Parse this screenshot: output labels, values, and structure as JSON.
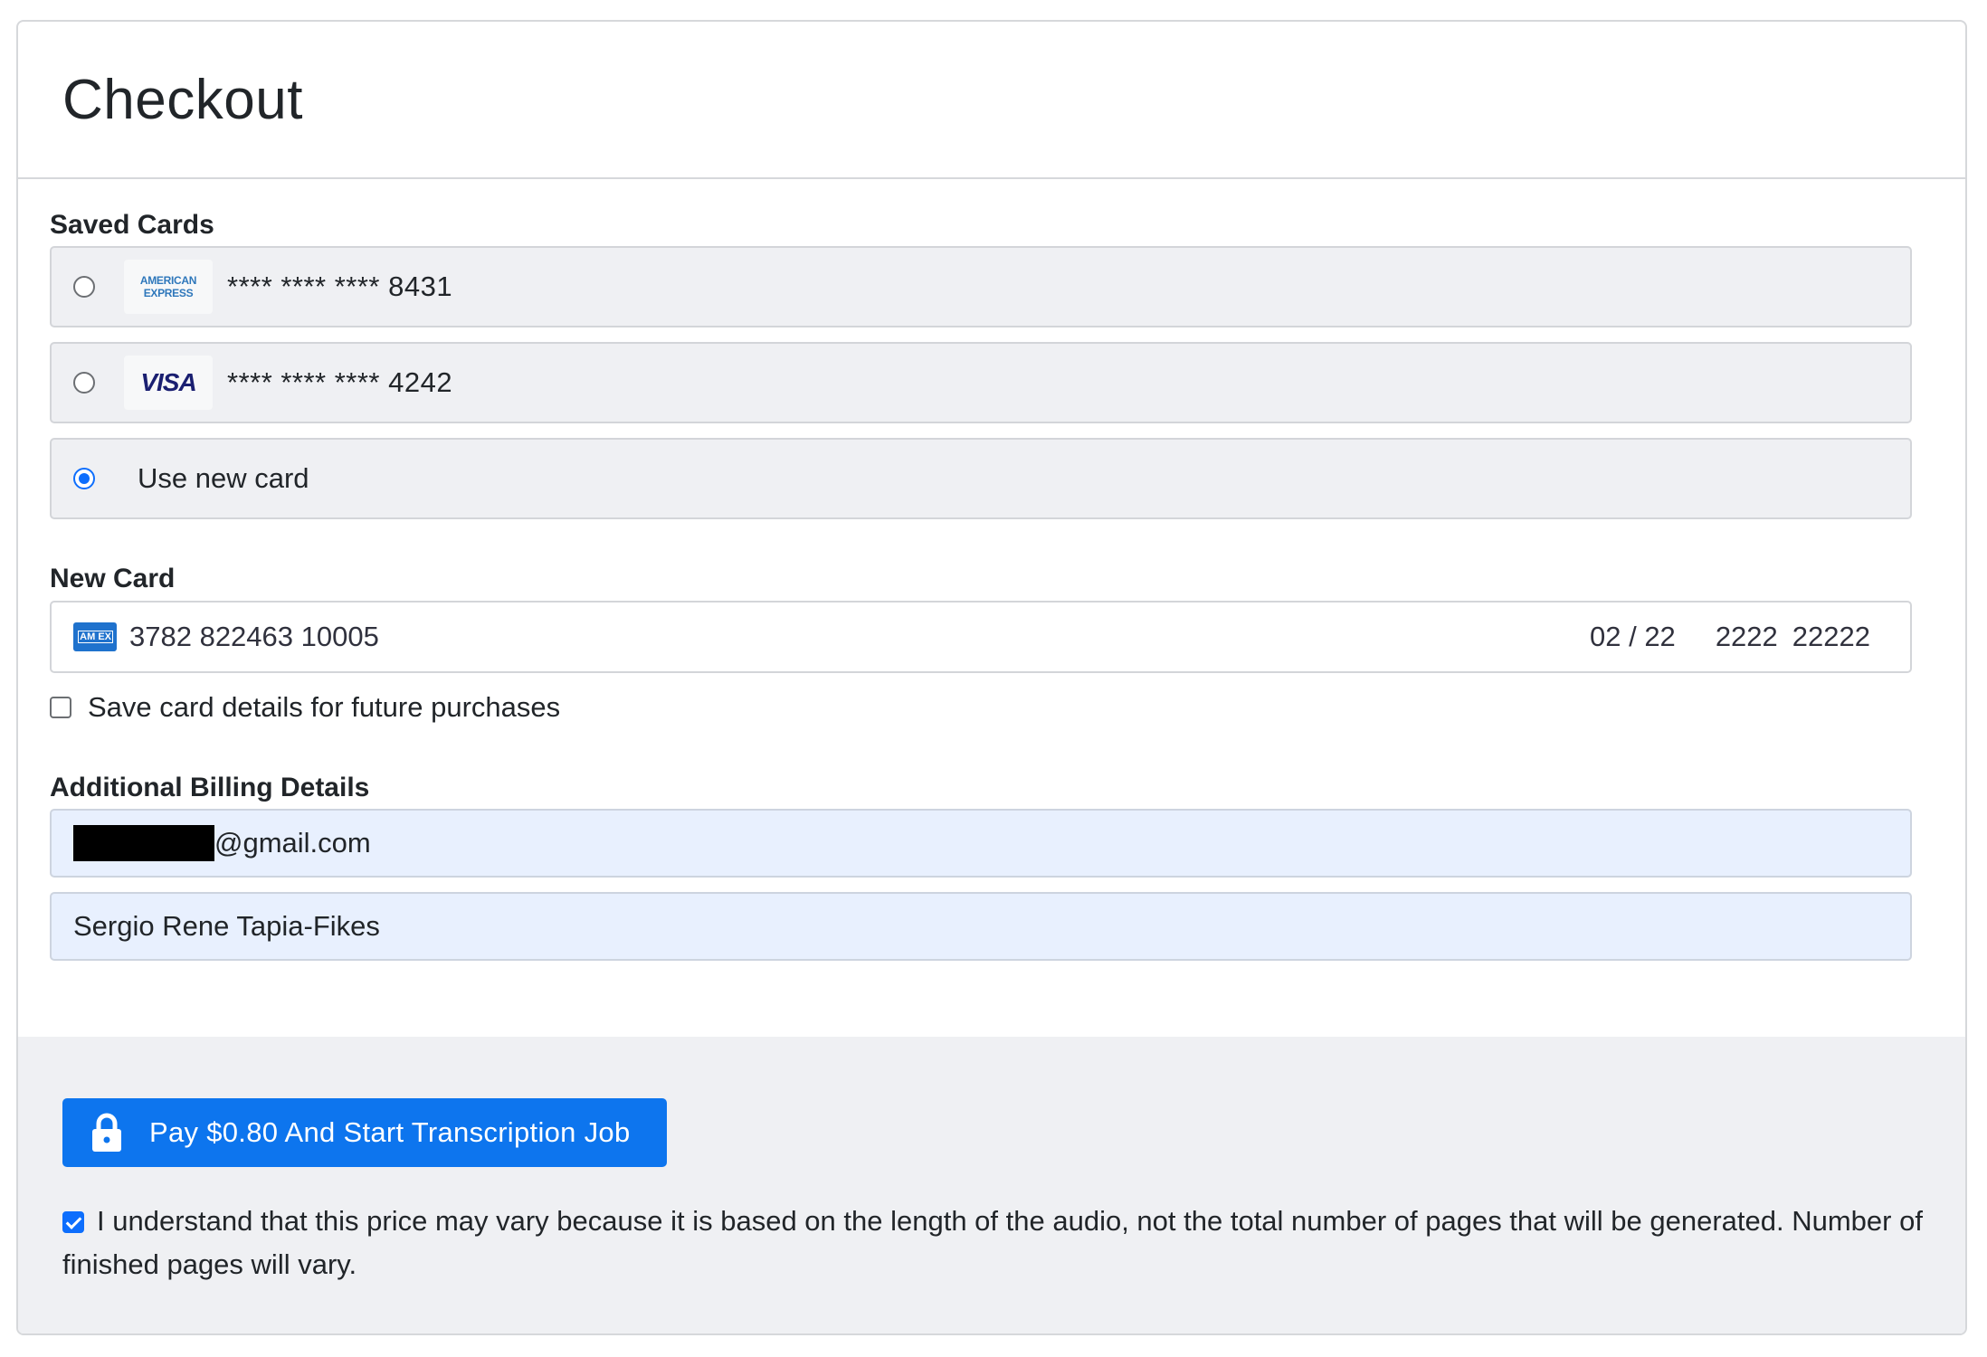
{
  "header": {
    "title": "Checkout"
  },
  "saved_cards": {
    "label": "Saved Cards",
    "cards": [
      {
        "brand": "American Express",
        "logo_line1": "AMERICAN",
        "logo_line2": "EXPRESS",
        "masked": "**** **** ****",
        "last4": "8431",
        "selected": false
      },
      {
        "brand": "Visa",
        "logo_text": "VISA",
        "masked": "**** **** ****",
        "last4": "4242",
        "selected": false
      }
    ],
    "new_card_option": {
      "label": "Use new card",
      "selected": true
    }
  },
  "new_card": {
    "label": "New Card",
    "brand_icon_text": "AM EX",
    "number": "3782 822463 10005",
    "expiry": "02 / 22",
    "cvc": "2222",
    "postal": "22222"
  },
  "save_card": {
    "label": "Save card details for future purchases",
    "checked": false
  },
  "billing": {
    "label": "Additional Billing Details",
    "email_suffix": "@gmail.com",
    "name": "Sergio Rene Tapia-Fikes"
  },
  "footer": {
    "pay_label": "Pay $0.80 And Start Transcription Job",
    "agree_text": "I understand that this price may vary because it is based on the length of the audio, not the total number of pages that will be generated. Number of finished pages will vary.",
    "agree_checked": true
  },
  "colors": {
    "primary": "#0d75ee",
    "panel_bg": "#eff0f3",
    "autofill_bg": "#e8f0fe"
  }
}
